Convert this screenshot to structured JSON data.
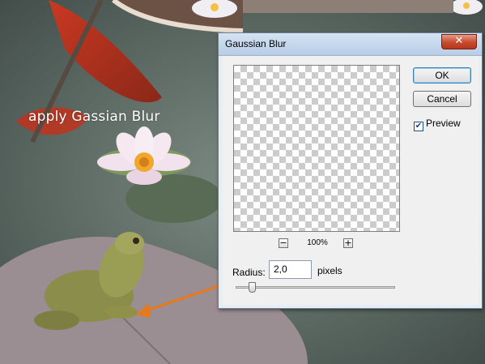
{
  "caption": "apply Gassian Blur",
  "dialog": {
    "title": "Gaussian Blur",
    "close_glyph": "✕",
    "zoom_out_glyph": "−",
    "zoom_level": "100%",
    "zoom_in_glyph": "+",
    "radius_label": "Radius:",
    "radius_value": "2,0",
    "radius_unit": "pixels",
    "ok_label": "OK",
    "cancel_label": "Cancel",
    "preview_label": "Preview",
    "preview_checked": true,
    "checkbox_glyph": "✔",
    "slider_fraction": 0.1
  },
  "colors": {
    "arrow": "#e8781c",
    "caption_text": "#ffffff"
  }
}
